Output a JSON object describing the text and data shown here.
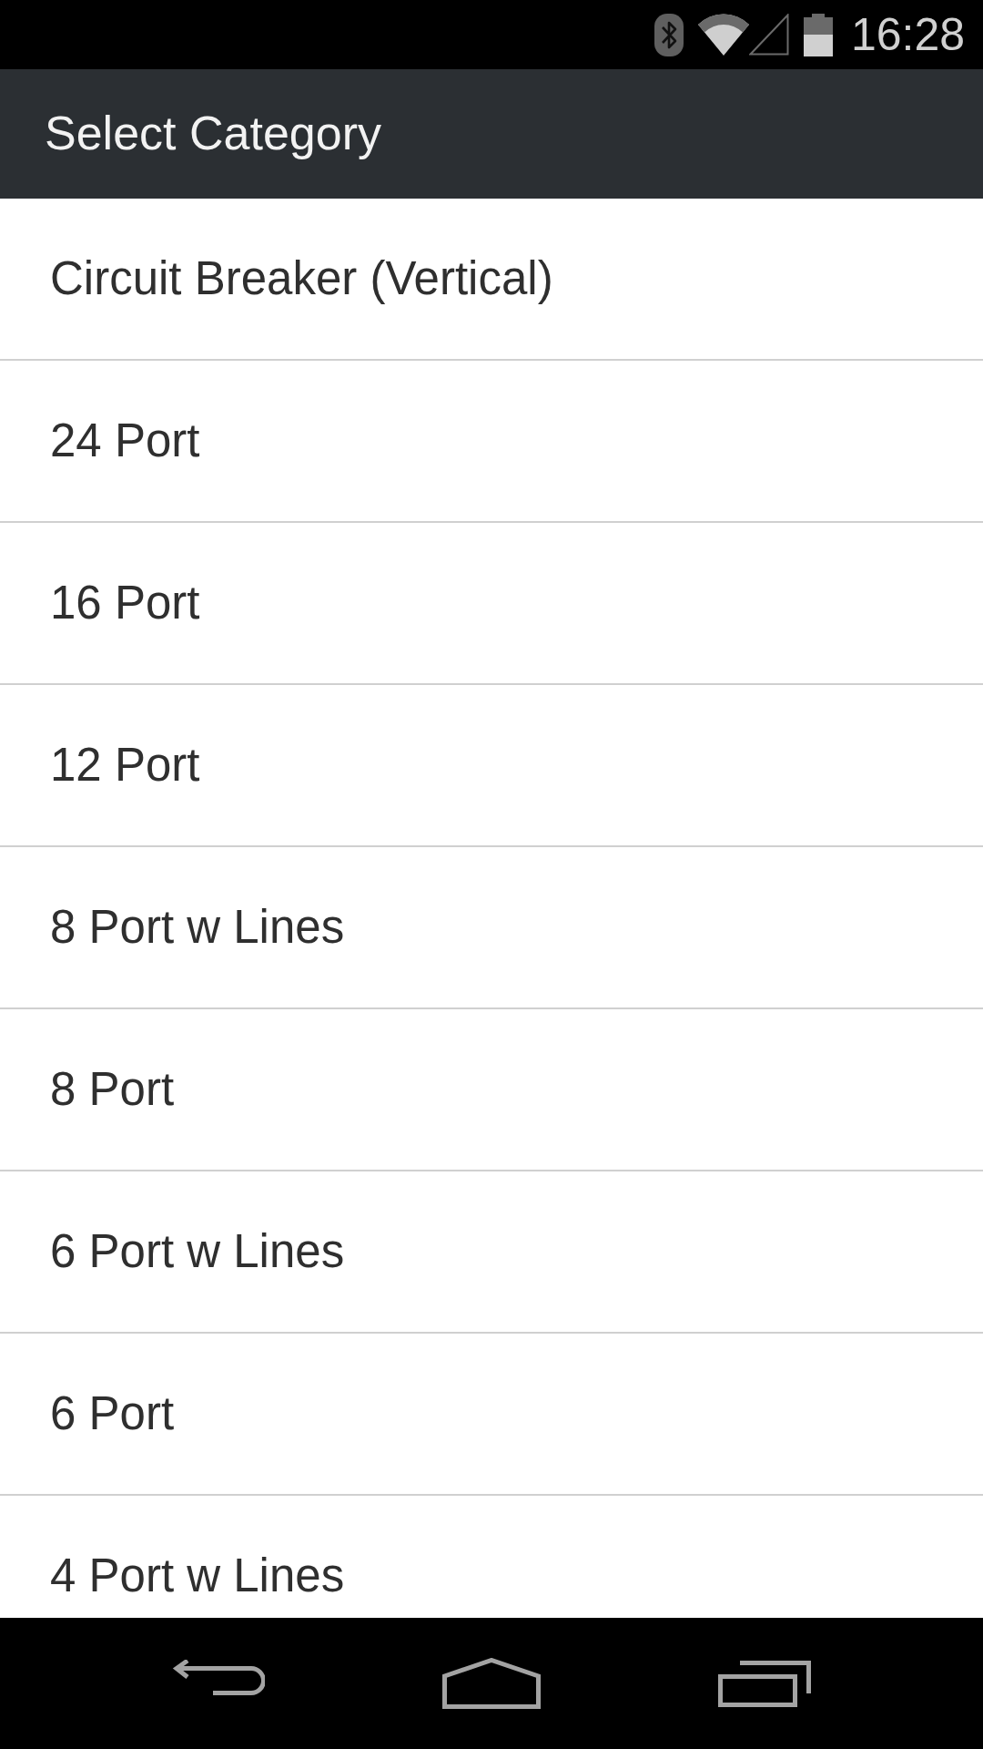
{
  "status_bar": {
    "time": "16:28"
  },
  "app_bar": {
    "title": "Select Category"
  },
  "categories": [
    {
      "label": "Circuit Breaker (Vertical)"
    },
    {
      "label": "24 Port"
    },
    {
      "label": "16 Port"
    },
    {
      "label": "12 Port"
    },
    {
      "label": "8 Port w Lines"
    },
    {
      "label": "8 Port"
    },
    {
      "label": "6 Port w Lines"
    },
    {
      "label": "6 Port"
    },
    {
      "label": "4 Port w Lines"
    }
  ]
}
